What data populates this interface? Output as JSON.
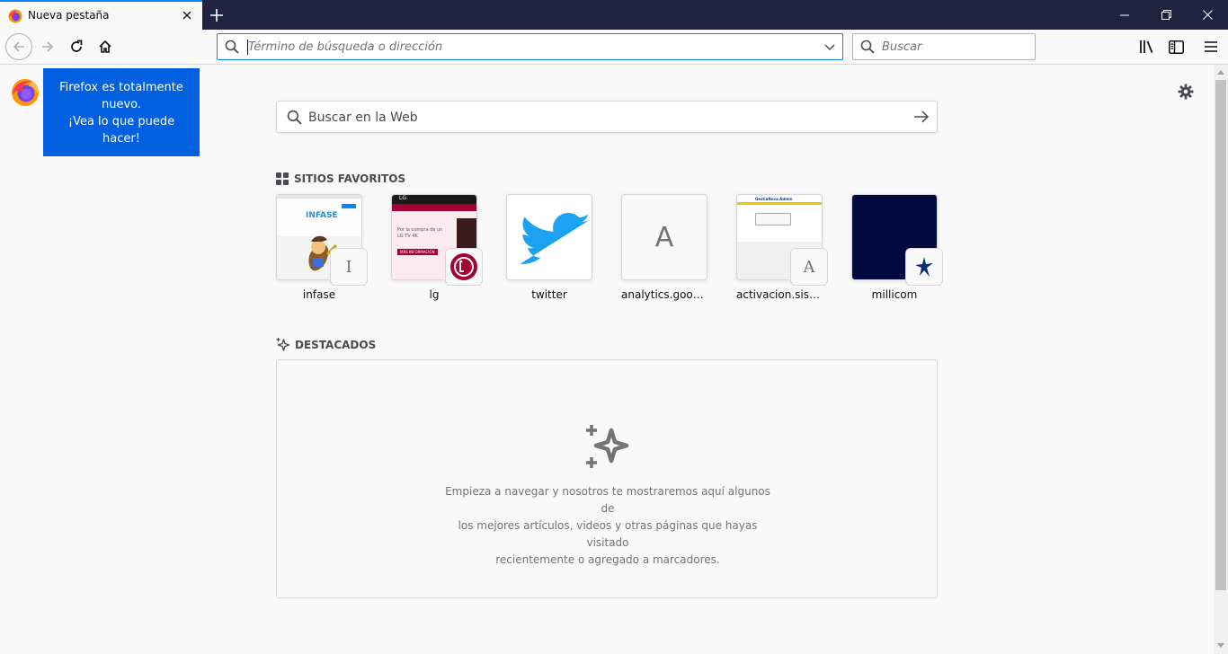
{
  "tab": {
    "title": "Nueva pestaña"
  },
  "urlbar": {
    "placeholder": "Término de búsqueda o dirección"
  },
  "searchbar": {
    "placeholder": "Buscar"
  },
  "onboarding": {
    "lines": [
      "Firefox es totalmente",
      "nuevo.",
      "¡Vea lo que puede",
      "hacer!"
    ]
  },
  "newtab": {
    "search_placeholder": "Buscar en la Web",
    "top_sites_title": "SITIOS FAVORITOS",
    "highlights_title": "DESTACADOS",
    "top_sites": [
      {
        "label": "infase",
        "badge": "I"
      },
      {
        "label": "lg",
        "badge": ""
      },
      {
        "label": "twitter",
        "badge": ""
      },
      {
        "label": "analytics.google",
        "badge": "A"
      },
      {
        "label": "activacion.sisno...",
        "badge": "A"
      },
      {
        "label": "millicom",
        "badge": ""
      }
    ],
    "highlights_message": [
      "Empieza a navegar y nosotros te mostraremos aquí algunos de",
      "los mejores artículos, videos y otras páginas que hayas visitado",
      "recientemente o agregado a marcadores."
    ]
  },
  "thumbnails": {
    "infase": {
      "logo_text": "INFASE"
    },
    "lg": {
      "brand": "LG",
      "text": "Por la compra de un LG TV 4K",
      "button": "MÁS INFORMACIÓN"
    },
    "activacion": {
      "header": "GestiaNova Admin"
    }
  },
  "colors": {
    "titlebar": "#202340",
    "accent": "#0a84ff",
    "bubble": "#0060df",
    "twitter": "#1da1f2",
    "lg_red": "#a50034",
    "millicom_bg": "#030a40"
  }
}
